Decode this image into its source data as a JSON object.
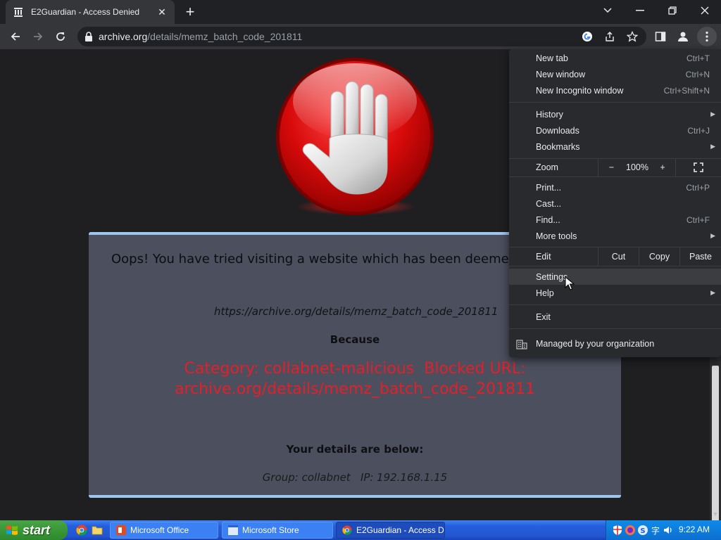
{
  "browser": {
    "tab_title": "E2Guardian - Access Denied",
    "url_host": "archive.org",
    "url_path": "/details/memz_batch_code_201811"
  },
  "page": {
    "oops": "Oops! You have tried visiting a website which has been deemed",
    "blocked_url": "https://archive.org/details/memz_batch_code_201811",
    "because": "Because",
    "reason_line1": "Category: collabnet-malicious  Blocked URL:",
    "reason_line2": "archive.org/details/memz_batch_code_201811",
    "details_heading": "Your details are below:",
    "details": "Group: collabnet   IP: 192.168.1.15"
  },
  "menu": {
    "new_tab": {
      "label": "New tab",
      "shortcut": "Ctrl+T"
    },
    "new_window": {
      "label": "New window",
      "shortcut": "Ctrl+N"
    },
    "new_incognito": {
      "label": "New Incognito window",
      "shortcut": "Ctrl+Shift+N"
    },
    "history": {
      "label": "History"
    },
    "downloads": {
      "label": "Downloads",
      "shortcut": "Ctrl+J"
    },
    "bookmarks": {
      "label": "Bookmarks"
    },
    "zoom": {
      "label": "Zoom",
      "minus": "−",
      "value": "100%",
      "plus": "+"
    },
    "print": {
      "label": "Print...",
      "shortcut": "Ctrl+P"
    },
    "cast": {
      "label": "Cast..."
    },
    "find": {
      "label": "Find...",
      "shortcut": "Ctrl+F"
    },
    "more_tools": {
      "label": "More tools"
    },
    "edit": {
      "label": "Edit",
      "cut": "Cut",
      "copy": "Copy",
      "paste": "Paste"
    },
    "settings": {
      "label": "Settings"
    },
    "help": {
      "label": "Help"
    },
    "exit": {
      "label": "Exit"
    },
    "managed": {
      "label": "Managed by your organization"
    }
  },
  "taskbar": {
    "start_label": "start",
    "buttons": [
      "Microsoft Office",
      "Microsoft Store",
      "E2Guardian - Access D..."
    ],
    "clock": "9:22 AM"
  },
  "colors": {
    "chrome_dark": "#35363a",
    "reason_red": "#e3202a",
    "card_bg": "#4b4f5e",
    "card_border": "#9ec7ef"
  }
}
